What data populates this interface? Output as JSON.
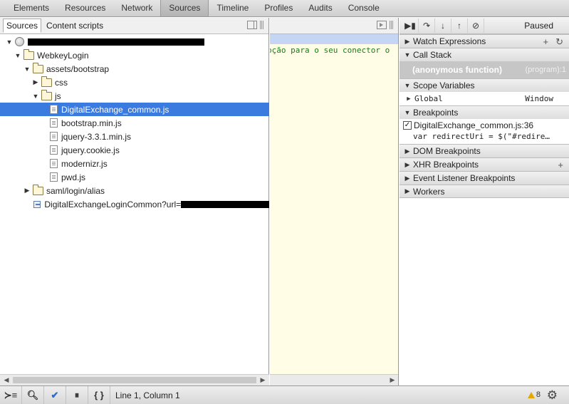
{
  "top_tabs": [
    {
      "label": "Elements"
    },
    {
      "label": "Resources"
    },
    {
      "label": "Network"
    },
    {
      "label": "Sources",
      "active": true
    },
    {
      "label": "Timeline"
    },
    {
      "label": "Profiles"
    },
    {
      "label": "Audits"
    },
    {
      "label": "Console"
    }
  ],
  "navigator": {
    "tabs": [
      "Sources",
      "Content scripts"
    ],
    "tree": {
      "root_redacted": true,
      "webkey_login": "WebkeyLogin",
      "assets_bootstrap": "assets/bootstrap",
      "css": "css",
      "js": "js",
      "files": [
        "DigitalExchange_common.js",
        "bootstrap.min.js",
        "jquery-3.3.1.min.js",
        "jquery.cookie.js",
        "modernizr.js",
        "pwd.js"
      ],
      "saml": "saml/login/alias",
      "common_url": "DigitalExchangeLoginCommon?url="
    }
  },
  "editor": {
    "code_fragment": "pção para o seu conector o"
  },
  "debugger": {
    "status": "Paused",
    "watch_expressions": "Watch Expressions",
    "call_stack": "Call Stack",
    "call_frame": {
      "name": "(anonymous function)",
      "location": "(program):1"
    },
    "scope_variables": "Scope Variables",
    "scope": {
      "name": "Global",
      "value": "Window"
    },
    "breakpoints": "Breakpoints",
    "breakpoint": {
      "file": "DigitalExchange_common.js:36",
      "code": "var redirectUri = $(\"#redire…"
    },
    "dom_breakpoints": "DOM Breakpoints",
    "xhr_breakpoints": "XHR Breakpoints",
    "event_listener_breakpoints": "Event Listener Breakpoints",
    "workers": "Workers"
  },
  "statusbar": {
    "cursor": "Line 1, Column 1",
    "warnings": "8"
  }
}
